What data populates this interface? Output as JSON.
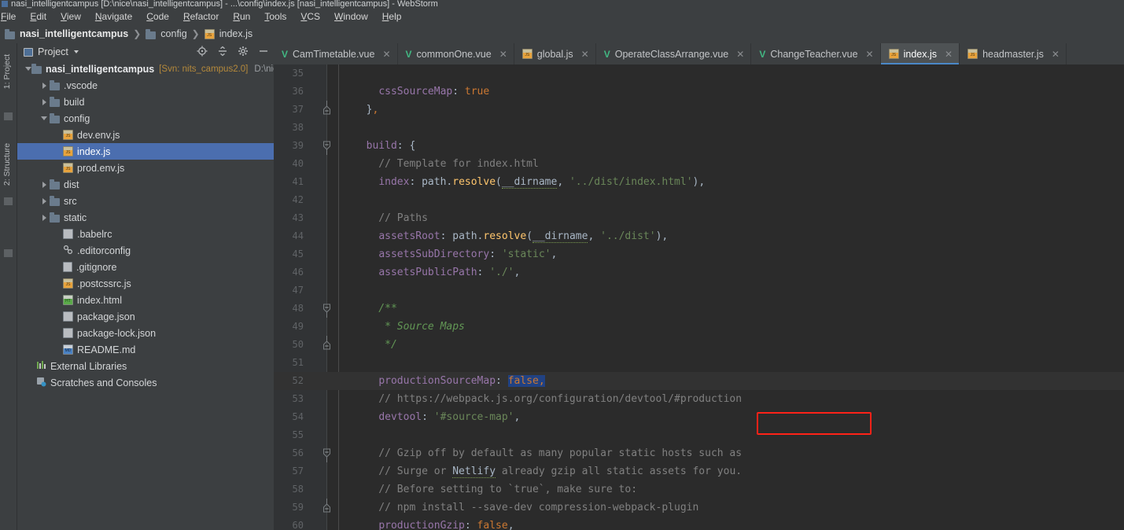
{
  "window": {
    "title": "nasi_intelligentcampus [D:\\nice\\nasi_intelligentcampus] - ...\\config\\index.js [nasi_intelligentcampus] - WebStorm"
  },
  "menubar": {
    "items": [
      "File",
      "Edit",
      "View",
      "Navigate",
      "Code",
      "Refactor",
      "Run",
      "Tools",
      "VCS",
      "Window",
      "Help"
    ]
  },
  "breadcrumb": {
    "items": [
      {
        "label": "nasi_intelligentcampus",
        "icon": "folder-icon"
      },
      {
        "label": "config",
        "icon": "folder-icon"
      },
      {
        "label": "index.js",
        "icon": "js-file-icon"
      }
    ],
    "separator": "❯"
  },
  "toolstrip": {
    "labels": [
      "1: Project",
      "2: Structure"
    ]
  },
  "project_panel": {
    "title": "Project",
    "chevron": "chevron-down-icon",
    "tools": [
      "locate-icon",
      "collapse-all-icon",
      "gear-icon",
      "hide-icon"
    ],
    "tree": [
      {
        "indent": 0,
        "twisty": "down",
        "icon": "folder-icon",
        "label": "nasi_intelligentcampus",
        "bold": true,
        "svn": "[Svn: nits_campus2.0]",
        "path": "D:\\nice",
        "selected": false
      },
      {
        "indent": 1,
        "twisty": "right",
        "icon": "folder-icon",
        "label": ".vscode",
        "selected": false
      },
      {
        "indent": 1,
        "twisty": "right",
        "icon": "folder-icon",
        "label": "build",
        "selected": false
      },
      {
        "indent": 1,
        "twisty": "down",
        "icon": "folder-icon",
        "label": "config",
        "selected": false
      },
      {
        "indent": 2,
        "twisty": "none",
        "icon": "js-file-icon",
        "label": "dev.env.js",
        "selected": false
      },
      {
        "indent": 2,
        "twisty": "none",
        "icon": "js-file-icon",
        "label": "index.js",
        "selected": true
      },
      {
        "indent": 2,
        "twisty": "none",
        "icon": "js-file-icon",
        "label": "prod.env.js",
        "selected": false
      },
      {
        "indent": 1,
        "twisty": "right",
        "icon": "folder-icon",
        "label": "dist",
        "selected": false
      },
      {
        "indent": 1,
        "twisty": "right",
        "icon": "folder-icon",
        "label": "src",
        "selected": false
      },
      {
        "indent": 1,
        "twisty": "right",
        "icon": "folder-icon",
        "label": "static",
        "selected": false
      },
      {
        "indent": 2,
        "twisty": "none",
        "icon": "json-file-icon",
        "label": ".babelrc",
        "selected": false
      },
      {
        "indent": 2,
        "twisty": "none",
        "icon": "editorconfig-file-icon",
        "label": ".editorconfig",
        "selected": false
      },
      {
        "indent": 2,
        "twisty": "none",
        "icon": "gitignore-file-icon",
        "label": ".gitignore",
        "selected": false
      },
      {
        "indent": 2,
        "twisty": "none",
        "icon": "js-file-icon",
        "label": ".postcssrc.js",
        "selected": false
      },
      {
        "indent": 2,
        "twisty": "none",
        "icon": "html-file-icon",
        "label": "index.html",
        "selected": false
      },
      {
        "indent": 2,
        "twisty": "none",
        "icon": "json-file-icon",
        "label": "package.json",
        "selected": false
      },
      {
        "indent": 2,
        "twisty": "none",
        "icon": "json-file-icon",
        "label": "package-lock.json",
        "selected": false
      },
      {
        "indent": 2,
        "twisty": "none",
        "icon": "md-file-icon",
        "label": "README.md",
        "selected": false
      },
      {
        "indent": 0,
        "twisty": "none",
        "icon": "library-icon",
        "label": "External Libraries",
        "selected": false
      },
      {
        "indent": 0,
        "twisty": "none",
        "icon": "scratches-icon",
        "label": "Scratches and Consoles",
        "selected": false
      }
    ]
  },
  "editor_tabs": [
    {
      "label": "CamTimetable.vue",
      "icon": "vue-file-icon",
      "active": false,
      "closable": true
    },
    {
      "label": "commonOne.vue",
      "icon": "vue-file-icon",
      "active": false,
      "closable": true
    },
    {
      "label": "global.js",
      "icon": "js-file-icon",
      "active": false,
      "closable": true
    },
    {
      "label": "OperateClassArrange.vue",
      "icon": "vue-file-icon",
      "active": false,
      "closable": true
    },
    {
      "label": "ChangeTeacher.vue",
      "icon": "vue-file-icon",
      "active": false,
      "closable": true
    },
    {
      "label": "index.js",
      "icon": "js-file-icon",
      "active": true,
      "closable": true
    },
    {
      "label": "headmaster.js",
      "icon": "js-file-icon",
      "active": false,
      "closable": true
    }
  ],
  "editor": {
    "filename": "index.js",
    "highlight_color": "#ff2218",
    "selection_color": "#214283",
    "first_visible_line": 35,
    "lines": [
      {
        "num": 35,
        "fold": "none",
        "current": false,
        "tokens": []
      },
      {
        "num": 36,
        "fold": "none",
        "current": false,
        "tokens": [
          {
            "t": "    ",
            "c": "d"
          },
          {
            "t": "cssSourceMap",
            "c": "p"
          },
          {
            "t": ": ",
            "c": "d"
          },
          {
            "t": "true",
            "c": "k"
          }
        ]
      },
      {
        "num": 37,
        "fold": "end",
        "current": false,
        "tokens": [
          {
            "t": "  }",
            "c": "d"
          },
          {
            "t": ",",
            "c": "k"
          }
        ]
      },
      {
        "num": 38,
        "fold": "none",
        "current": false,
        "tokens": []
      },
      {
        "num": 39,
        "fold": "start",
        "current": false,
        "tokens": [
          {
            "t": "  ",
            "c": "d"
          },
          {
            "t": "build",
            "c": "p"
          },
          {
            "t": ": {",
            "c": "d"
          }
        ]
      },
      {
        "num": 40,
        "fold": "none",
        "current": false,
        "tokens": [
          {
            "t": "    // Template for index.html",
            "c": "c"
          }
        ]
      },
      {
        "num": 41,
        "fold": "none",
        "current": false,
        "tokens": [
          {
            "t": "    ",
            "c": "d"
          },
          {
            "t": "index",
            "c": "p"
          },
          {
            "t": ": path.",
            "c": "d"
          },
          {
            "t": "resolve",
            "c": "fn"
          },
          {
            "t": "(",
            "c": "d"
          },
          {
            "t": "__dirname",
            "c": "wav"
          },
          {
            "t": ", ",
            "c": "d"
          },
          {
            "t": "'../dist/index.html'",
            "c": "s"
          },
          {
            "t": "),",
            "c": "d"
          }
        ]
      },
      {
        "num": 42,
        "fold": "none",
        "current": false,
        "tokens": []
      },
      {
        "num": 43,
        "fold": "none",
        "current": false,
        "tokens": [
          {
            "t": "    // Paths",
            "c": "c"
          }
        ]
      },
      {
        "num": 44,
        "fold": "none",
        "current": false,
        "tokens": [
          {
            "t": "    ",
            "c": "d"
          },
          {
            "t": "assetsRoot",
            "c": "p"
          },
          {
            "t": ": path.",
            "c": "d"
          },
          {
            "t": "resolve",
            "c": "fn"
          },
          {
            "t": "(",
            "c": "d"
          },
          {
            "t": "__dirname",
            "c": "wav"
          },
          {
            "t": ", ",
            "c": "d"
          },
          {
            "t": "'../dist'",
            "c": "s"
          },
          {
            "t": "),",
            "c": "d"
          }
        ]
      },
      {
        "num": 45,
        "fold": "none",
        "current": false,
        "tokens": [
          {
            "t": "    ",
            "c": "d"
          },
          {
            "t": "assetsSubDirectory",
            "c": "p"
          },
          {
            "t": ": ",
            "c": "d"
          },
          {
            "t": "'static'",
            "c": "s"
          },
          {
            "t": ",",
            "c": "d"
          }
        ]
      },
      {
        "num": 46,
        "fold": "none",
        "current": false,
        "tokens": [
          {
            "t": "    ",
            "c": "d"
          },
          {
            "t": "assetsPublicPath",
            "c": "p"
          },
          {
            "t": ": ",
            "c": "d"
          },
          {
            "t": "'./'",
            "c": "s"
          },
          {
            "t": ",",
            "c": "d"
          }
        ]
      },
      {
        "num": 47,
        "fold": "none",
        "current": false,
        "tokens": []
      },
      {
        "num": 48,
        "fold": "start",
        "current": false,
        "tokens": [
          {
            "t": "    /**",
            "c": "cd"
          }
        ]
      },
      {
        "num": 49,
        "fold": "none",
        "current": false,
        "tokens": [
          {
            "t": "     * Source Maps",
            "c": "cd"
          }
        ]
      },
      {
        "num": 50,
        "fold": "end",
        "current": false,
        "tokens": [
          {
            "t": "     */",
            "c": "cd"
          }
        ]
      },
      {
        "num": 51,
        "fold": "none",
        "current": false,
        "tokens": []
      },
      {
        "num": 52,
        "fold": "none",
        "current": true,
        "tokens": [
          {
            "t": "    ",
            "c": "d"
          },
          {
            "t": "productionSourceMap",
            "c": "p"
          },
          {
            "t": ": ",
            "c": "d"
          },
          {
            "t": "false",
            "c": "k",
            "sel": true
          },
          {
            "t": ",",
            "c": "k",
            "sel": true
          }
        ]
      },
      {
        "num": 53,
        "fold": "none",
        "current": false,
        "tokens": [
          {
            "t": "    // https://webpack.js.org/configuration/devtool/#production",
            "c": "c"
          }
        ]
      },
      {
        "num": 54,
        "fold": "none",
        "current": false,
        "tokens": [
          {
            "t": "    ",
            "c": "d"
          },
          {
            "t": "devtool",
            "c": "p"
          },
          {
            "t": ": ",
            "c": "d"
          },
          {
            "t": "'#source-map'",
            "c": "s"
          },
          {
            "t": ",",
            "c": "d"
          }
        ]
      },
      {
        "num": 55,
        "fold": "none",
        "current": false,
        "tokens": []
      },
      {
        "num": 56,
        "fold": "start",
        "current": false,
        "tokens": [
          {
            "t": "    // Gzip off by default as many popular static hosts such as",
            "c": "c"
          }
        ]
      },
      {
        "num": 57,
        "fold": "none",
        "current": false,
        "tokens": [
          {
            "t": "    // Surge or ",
            "c": "c"
          },
          {
            "t": "Netlify",
            "c": "wav"
          },
          {
            "t": " already gzip all static assets for you.",
            "c": "c"
          }
        ]
      },
      {
        "num": 58,
        "fold": "none",
        "current": false,
        "tokens": [
          {
            "t": "    // Before setting to `true`, make sure to:",
            "c": "c"
          }
        ]
      },
      {
        "num": 59,
        "fold": "end",
        "current": false,
        "tokens": [
          {
            "t": "    // npm install --save-dev compression-webpack-plugin",
            "c": "c"
          }
        ]
      },
      {
        "num": 60,
        "fold": "none",
        "current": false,
        "tokens": [
          {
            "t": "    ",
            "c": "d"
          },
          {
            "t": "productionGzip",
            "c": "p"
          },
          {
            "t": ": ",
            "c": "d"
          },
          {
            "t": "false",
            "c": "k"
          },
          {
            "t": ",",
            "c": "d"
          }
        ]
      }
    ]
  }
}
